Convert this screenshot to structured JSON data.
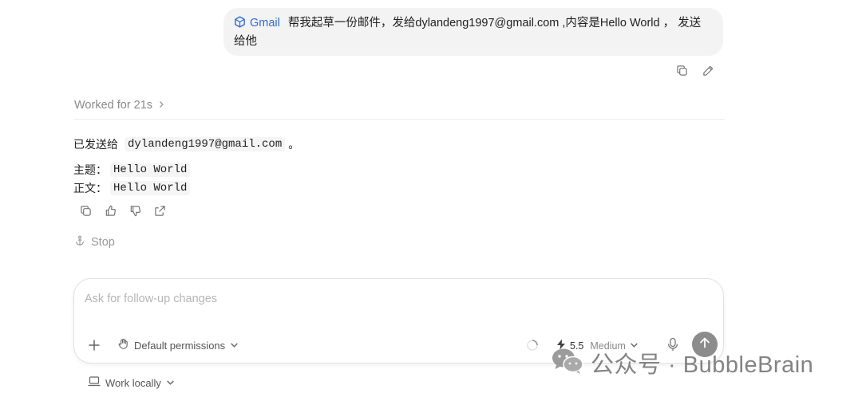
{
  "user_message": {
    "app_tag": "Gmail",
    "text": "帮我起草一份邮件，发给dylandeng1997@gmail.com ,内容是Hello World ， 发送给他"
  },
  "worked": {
    "label": "Worked for 21s"
  },
  "response": {
    "sent_prefix": "已发送给",
    "email": "dylandeng1997@gmail.com",
    "sent_suffix": "。",
    "subject_label": "主题：",
    "subject_value": "Hello World",
    "body_label": "正文：",
    "body_value": "Hello World"
  },
  "stop": {
    "label": "Stop"
  },
  "composer": {
    "placeholder": "Ask for follow-up changes",
    "permissions_label": "Default permissions",
    "model_version": "5.5",
    "model_effort": "Medium"
  },
  "footer": {
    "work_locally_label": "Work locally"
  },
  "watermark": {
    "text": "公众号 · BubbleBrain"
  },
  "colors": {
    "accent": "#2f6bd6",
    "bubble_bg": "#f3f3f4",
    "send_button": "#8c8c8c"
  }
}
